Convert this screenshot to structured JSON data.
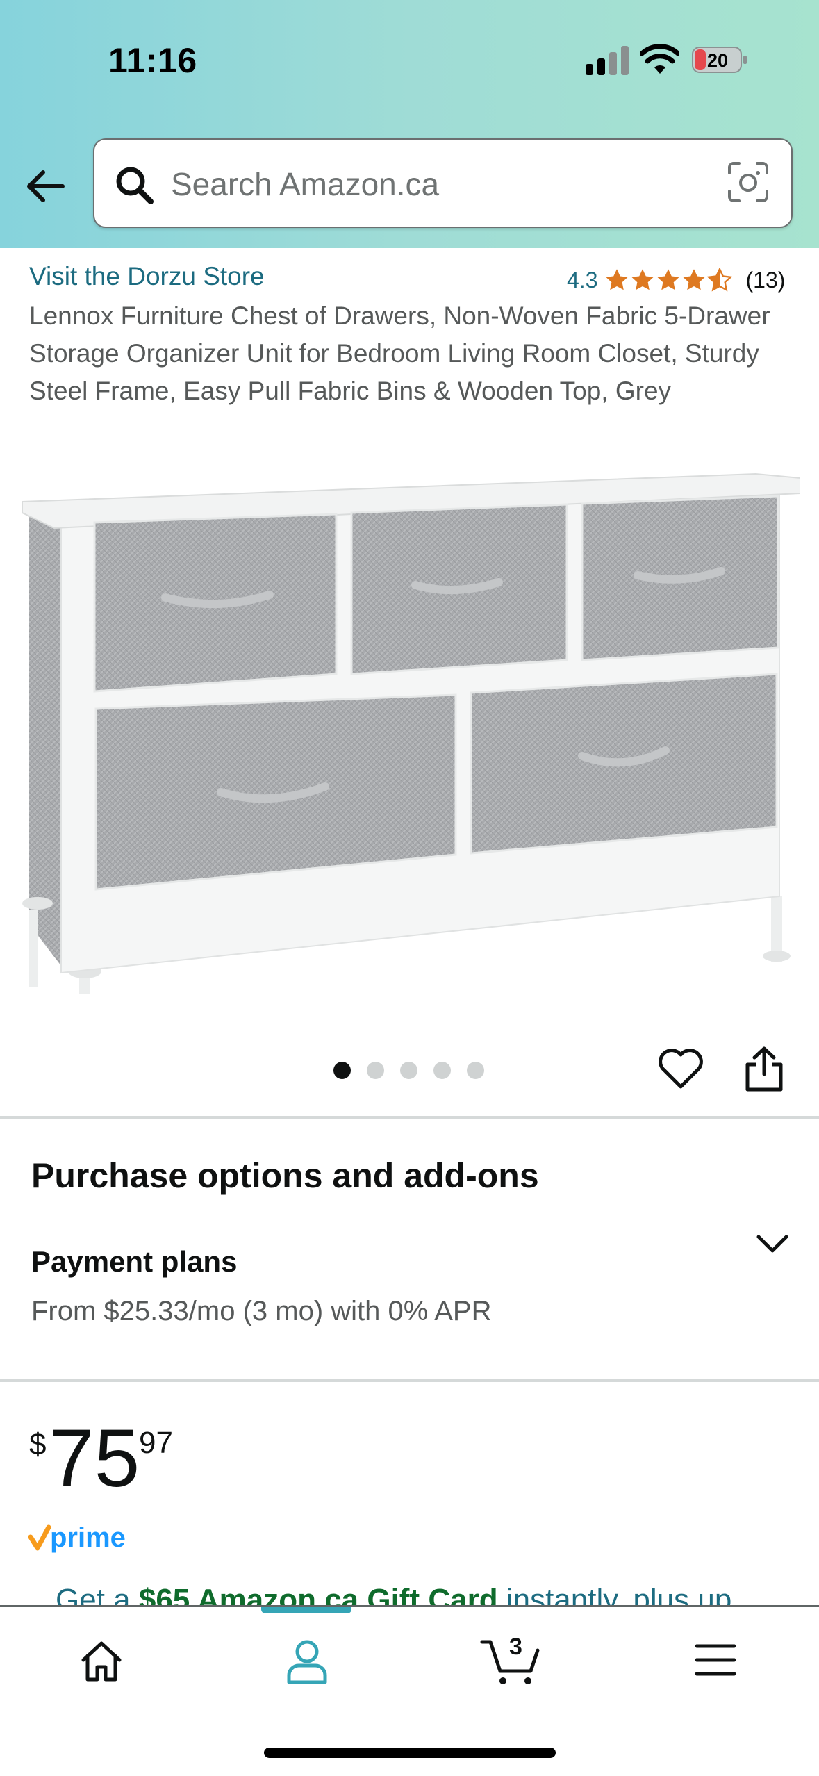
{
  "status_bar": {
    "time": "11:16",
    "battery_level": "20",
    "battery_color": "#e5484d"
  },
  "header": {
    "search_placeholder": "Search Amazon.ca",
    "background_gradient": [
      "#86d3dc",
      "#a7e3cf"
    ]
  },
  "product": {
    "store_link": "Visit the Dorzu Store",
    "rating": "4.3",
    "rating_count": "(13)",
    "stars_filled": 4.3,
    "title": "Lennox Furniture Chest of Drawers, Non-Woven Fabric 5-Drawer Storage Organizer Unit for Bedroom Living Room Closet, Sturdy Steel Frame, Easy Pull Fabric Bins & Wooden Top, Grey",
    "image_count": 5,
    "active_image_index": 0
  },
  "purchase_options": {
    "title": "Purchase options and add-ons",
    "payment_heading": "Payment plans",
    "payment_text": "From $25.33/mo (3 mo) with 0% APR"
  },
  "price": {
    "symbol": "$",
    "whole": "75",
    "fraction": "97"
  },
  "prime": {
    "label": "prime"
  },
  "promo": {
    "prefix": "Get a ",
    "highlight": "$65 Amazon.ca Gift Card",
    "suffix": " instantly, plus up"
  },
  "bottom_nav": {
    "cart_count": "3",
    "active_tab": "account",
    "accent_color": "#35a5b6"
  },
  "icons": [
    "back-arrow-icon",
    "search-icon",
    "camera-icon",
    "star-icon",
    "heart-icon",
    "share-icon",
    "chevron-down-icon",
    "home-icon",
    "account-icon",
    "cart-icon",
    "menu-icon"
  ]
}
